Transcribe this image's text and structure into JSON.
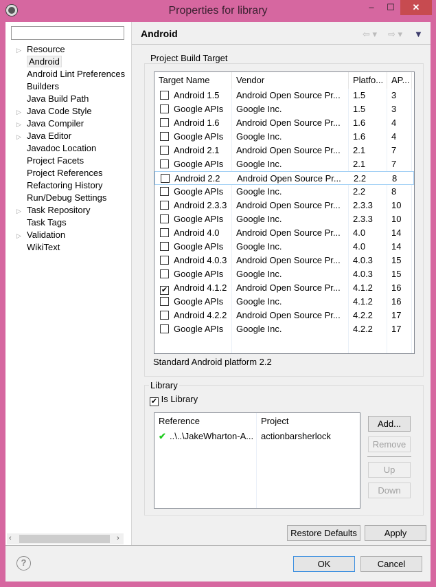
{
  "window": {
    "title": "Properties for library",
    "minimize": "‒",
    "maximize": "☐",
    "close": "✕"
  },
  "sidebar": {
    "filter_value": "",
    "items": [
      {
        "label": "Resource",
        "expandable": true
      },
      {
        "label": "Android",
        "expandable": false,
        "selected": true
      },
      {
        "label": "Android Lint Preferences",
        "expandable": false
      },
      {
        "label": "Builders",
        "expandable": false
      },
      {
        "label": "Java Build Path",
        "expandable": false
      },
      {
        "label": "Java Code Style",
        "expandable": true
      },
      {
        "label": "Java Compiler",
        "expandable": true
      },
      {
        "label": "Java Editor",
        "expandable": true
      },
      {
        "label": "Javadoc Location",
        "expandable": false
      },
      {
        "label": "Project Facets",
        "expandable": false
      },
      {
        "label": "Project References",
        "expandable": false
      },
      {
        "label": "Refactoring History",
        "expandable": false
      },
      {
        "label": "Run/Debug Settings",
        "expandable": false
      },
      {
        "label": "Task Repository",
        "expandable": true
      },
      {
        "label": "Task Tags",
        "expandable": false
      },
      {
        "label": "Validation",
        "expandable": true
      },
      {
        "label": "WikiText",
        "expandable": false
      }
    ]
  },
  "page": {
    "title": "Android"
  },
  "build_target": {
    "group_label": "Project Build Target",
    "columns": [
      "Target Name",
      "Vendor",
      "Platfo...",
      "AP..."
    ],
    "rows": [
      [
        "Android 1.5",
        "Android Open Source Pr...",
        "1.5",
        "3",
        false
      ],
      [
        "Google APIs",
        "Google Inc.",
        "1.5",
        "3",
        false
      ],
      [
        "Android 1.6",
        "Android Open Source Pr...",
        "1.6",
        "4",
        false
      ],
      [
        "Google APIs",
        "Google Inc.",
        "1.6",
        "4",
        false
      ],
      [
        "Android 2.1",
        "Android Open Source Pr...",
        "2.1",
        "7",
        false
      ],
      [
        "Google APIs",
        "Google Inc.",
        "2.1",
        "7",
        false
      ],
      [
        "Android 2.2",
        "Android Open Source Pr...",
        "2.2",
        "8",
        false
      ],
      [
        "Google APIs",
        "Google Inc.",
        "2.2",
        "8",
        false
      ],
      [
        "Android 2.3.3",
        "Android Open Source Pr...",
        "2.3.3",
        "10",
        false
      ],
      [
        "Google APIs",
        "Google Inc.",
        "2.3.3",
        "10",
        false
      ],
      [
        "Android 4.0",
        "Android Open Source Pr...",
        "4.0",
        "14",
        false
      ],
      [
        "Google APIs",
        "Google Inc.",
        "4.0",
        "14",
        false
      ],
      [
        "Android 4.0.3",
        "Android Open Source Pr...",
        "4.0.3",
        "15",
        false
      ],
      [
        "Google APIs",
        "Google Inc.",
        "4.0.3",
        "15",
        false
      ],
      [
        "Android 4.1.2",
        "Android Open Source Pr...",
        "4.1.2",
        "16",
        true
      ],
      [
        "Google APIs",
        "Google Inc.",
        "4.1.2",
        "16",
        false
      ],
      [
        "Android 4.2.2",
        "Android Open Source Pr...",
        "4.2.2",
        "17",
        false
      ],
      [
        "Google APIs",
        "Google Inc.",
        "4.2.2",
        "17",
        false
      ]
    ],
    "highlighted_row": 6,
    "status": "Standard Android platform 2.2"
  },
  "library": {
    "group_label": "Library",
    "is_library_label": "Is Library",
    "is_library": true,
    "columns": [
      "Reference",
      "Project"
    ],
    "rows": [
      {
        "reference": "..\\..\\JakeWharton-A...",
        "project": "actionbarsherlock"
      }
    ],
    "buttons": {
      "add": "Add...",
      "remove": "Remove",
      "up": "Up",
      "down": "Down"
    }
  },
  "buttons": {
    "restore_defaults": "Restore Defaults",
    "apply": "Apply",
    "ok": "OK",
    "cancel": "Cancel"
  },
  "colors": {
    "title_bar": "#d667a0",
    "close_button": "#c74b50",
    "check_ok": "#22cc22"
  }
}
